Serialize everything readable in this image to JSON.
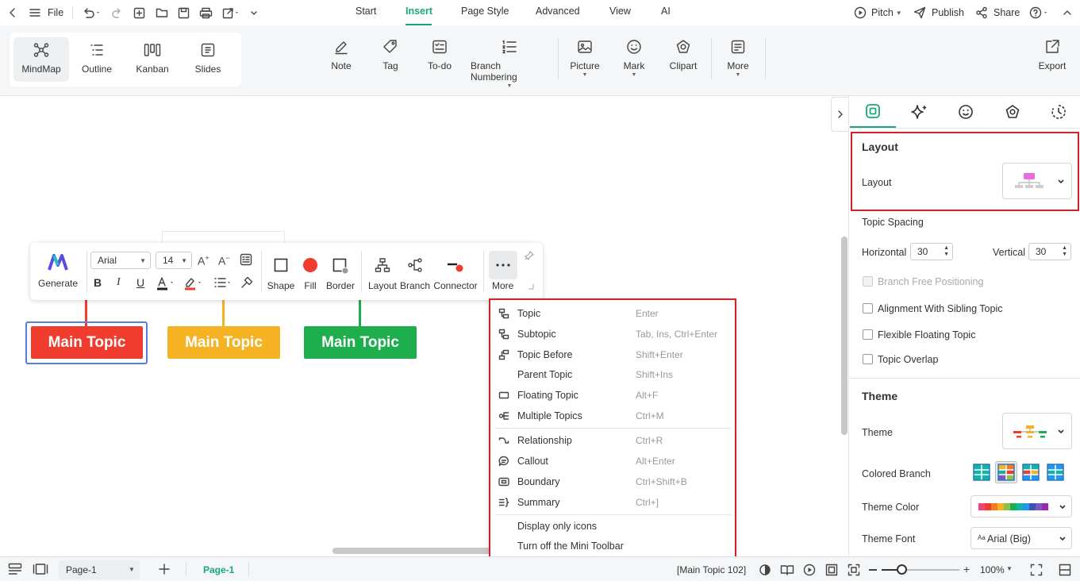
{
  "menubar": {
    "file": "File",
    "tabs": [
      "Start",
      "Insert",
      "Page Style",
      "Advanced",
      "View",
      "AI"
    ],
    "active_tab": "Insert",
    "pitch": "Pitch",
    "publish": "Publish",
    "share": "Share"
  },
  "views": [
    "MindMap",
    "Outline",
    "Kanban",
    "Slides"
  ],
  "ribbon": {
    "note": "Note",
    "tag": "Tag",
    "todo": "To-do",
    "branch_numbering": "Branch Numbering",
    "picture": "Picture",
    "mark": "Mark",
    "clipart": "Clipart",
    "more": "More",
    "export": "Export"
  },
  "topics": [
    {
      "label": "Main Topic",
      "color": "#f03c2e"
    },
    {
      "label": "Main Topic",
      "color": "#f5b324"
    },
    {
      "label": "Main Topic",
      "color": "#1fae4e"
    }
  ],
  "mini_toolbar": {
    "generate": "Generate",
    "font": "Arial",
    "size": "14",
    "shape": "Shape",
    "fill": "Fill",
    "border": "Border",
    "layout": "Layout",
    "branch": "Branch",
    "connector": "Connector",
    "more": "More"
  },
  "context_menu": {
    "items": [
      {
        "label": "Topic",
        "shortcut": "Enter"
      },
      {
        "label": "Subtopic",
        "shortcut": "Tab, Ins, Ctrl+Enter"
      },
      {
        "label": "Topic Before",
        "shortcut": "Shift+Enter"
      },
      {
        "label": "Parent Topic",
        "shortcut": "Shift+Ins"
      },
      {
        "label": "Floating Topic",
        "shortcut": "Alt+F"
      },
      {
        "label": "Multiple Topics",
        "shortcut": "Ctrl+M"
      },
      {
        "label": "Relationship",
        "shortcut": "Ctrl+R"
      },
      {
        "label": "Callout",
        "shortcut": "Alt+Enter"
      },
      {
        "label": "Boundary",
        "shortcut": "Ctrl+Shift+B"
      },
      {
        "label": "Summary",
        "shortcut": "Ctrl+]"
      },
      {
        "label": "Display only icons",
        "shortcut": ""
      },
      {
        "label": "Turn off the Mini Toolbar",
        "shortcut": ""
      }
    ]
  },
  "panel": {
    "layout_heading": "Layout",
    "layout_label": "Layout",
    "topic_spacing": "Topic Spacing",
    "horizontal": "Horizontal",
    "horizontal_value": "30",
    "vertical": "Vertical",
    "vertical_value": "30",
    "branch_free": "Branch Free Positioning",
    "align_sibling": "Alignment With Sibling Topic",
    "flexible_floating": "Flexible Floating Topic",
    "topic_overlap": "Topic Overlap",
    "theme_heading": "Theme",
    "theme_label": "Theme",
    "colored_branch": "Colored Branch",
    "theme_color": "Theme Color",
    "theme_font": "Theme Font",
    "theme_font_value": "Arial (Big)",
    "theme_font_prefix": "Aa"
  },
  "status": {
    "page_select": "Page-1",
    "page_tab": "Page-1",
    "selection": "[Main Topic 102]",
    "zoom": "100%"
  },
  "colors": {
    "accent": "#19a87a",
    "highlight": "#d3232a",
    "swatches": [
      "#f0447a",
      "#f03c2e",
      "#f57a20",
      "#f5b324",
      "#8bc34a",
      "#1fae4e",
      "#12b5a5",
      "#2196f3",
      "#3f51b5",
      "#7e57c2",
      "#9c27b0"
    ]
  }
}
